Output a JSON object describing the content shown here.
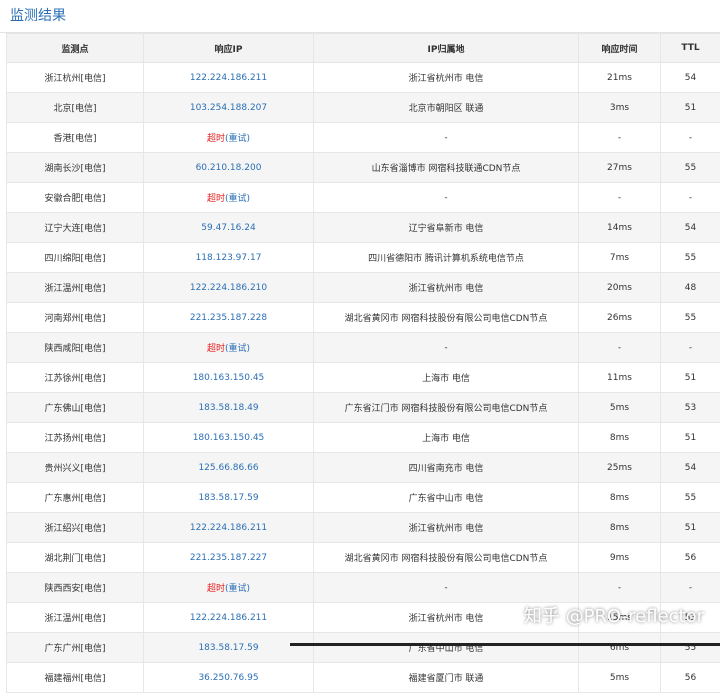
{
  "title": "监测结果",
  "columns": [
    "监测点",
    "响应IP",
    "IP归属地",
    "响应时间",
    "TTL"
  ],
  "rows": [
    {
      "point": "浙江杭州[电信]",
      "ip": "122.224.186.211",
      "loc": "浙江省杭州市 电信",
      "time": "21ms",
      "ttl": "54"
    },
    {
      "point": "北京[电信]",
      "ip": "103.254.188.207",
      "loc": "北京市朝阳区 联通",
      "time": "3ms",
      "ttl": "51"
    },
    {
      "point": "香港[电信]",
      "timeout": true,
      "loc": "-",
      "time": "-",
      "ttl": "-"
    },
    {
      "point": "湖南长沙[电信]",
      "ip": "60.210.18.200",
      "loc": "山东省淄博市 网宿科技联通CDN节点",
      "time": "27ms",
      "ttl": "55"
    },
    {
      "point": "安徽合肥[电信]",
      "timeout": true,
      "loc": "-",
      "time": "-",
      "ttl": "-"
    },
    {
      "point": "辽宁大连[电信]",
      "ip": "59.47.16.24",
      "loc": "辽宁省阜新市 电信",
      "time": "14ms",
      "ttl": "54"
    },
    {
      "point": "四川绵阳[电信]",
      "ip": "118.123.97.17",
      "loc": "四川省德阳市 腾讯计算机系统电信节点",
      "time": "7ms",
      "ttl": "55"
    },
    {
      "point": "浙江温州[电信]",
      "ip": "122.224.186.210",
      "loc": "浙江省杭州市 电信",
      "time": "20ms",
      "ttl": "48"
    },
    {
      "point": "河南郑州[电信]",
      "ip": "221.235.187.228",
      "loc": "湖北省黄冈市 网宿科技股份有限公司电信CDN节点",
      "time": "26ms",
      "ttl": "55"
    },
    {
      "point": "陕西咸阳[电信]",
      "timeout": true,
      "loc": "-",
      "time": "-",
      "ttl": "-"
    },
    {
      "point": "江苏徐州[电信]",
      "ip": "180.163.150.45",
      "loc": "上海市 电信",
      "time": "11ms",
      "ttl": "51"
    },
    {
      "point": "广东佛山[电信]",
      "ip": "183.58.18.49",
      "loc": "广东省江门市 网宿科技股份有限公司电信CDN节点",
      "time": "5ms",
      "ttl": "53"
    },
    {
      "point": "江苏扬州[电信]",
      "ip": "180.163.150.45",
      "loc": "上海市 电信",
      "time": "8ms",
      "ttl": "51"
    },
    {
      "point": "贵州兴义[电信]",
      "ip": "125.66.86.66",
      "loc": "四川省南充市 电信",
      "time": "25ms",
      "ttl": "54"
    },
    {
      "point": "广东惠州[电信]",
      "ip": "183.58.17.59",
      "loc": "广东省中山市 电信",
      "time": "8ms",
      "ttl": "55"
    },
    {
      "point": "浙江绍兴[电信]",
      "ip": "122.224.186.211",
      "loc": "浙江省杭州市 电信",
      "time": "8ms",
      "ttl": "51"
    },
    {
      "point": "湖北荆门[电信]",
      "ip": "221.235.187.227",
      "loc": "湖北省黄冈市 网宿科技股份有限公司电信CDN节点",
      "time": "9ms",
      "ttl": "56"
    },
    {
      "point": "陕西西安[电信]",
      "timeout": true,
      "loc": "-",
      "time": "-",
      "ttl": "-"
    },
    {
      "point": "浙江温州[电信]",
      "ip": "122.224.186.211",
      "loc": "浙江省杭州市 电信",
      "time": "15ms",
      "ttl": "53"
    },
    {
      "point": "广东广州[电信]",
      "ip": "183.58.17.59",
      "loc": "广东省中山市 电信",
      "time": "6ms",
      "ttl": "55"
    },
    {
      "point": "福建福州[电信]",
      "ip": "36.250.76.95",
      "loc": "福建省厦门市 联通",
      "time": "5ms",
      "ttl": "56"
    }
  ],
  "timeout_label": "超时",
  "retry_label": "(重试)",
  "watermark": "知乎 @PRO-reflector"
}
